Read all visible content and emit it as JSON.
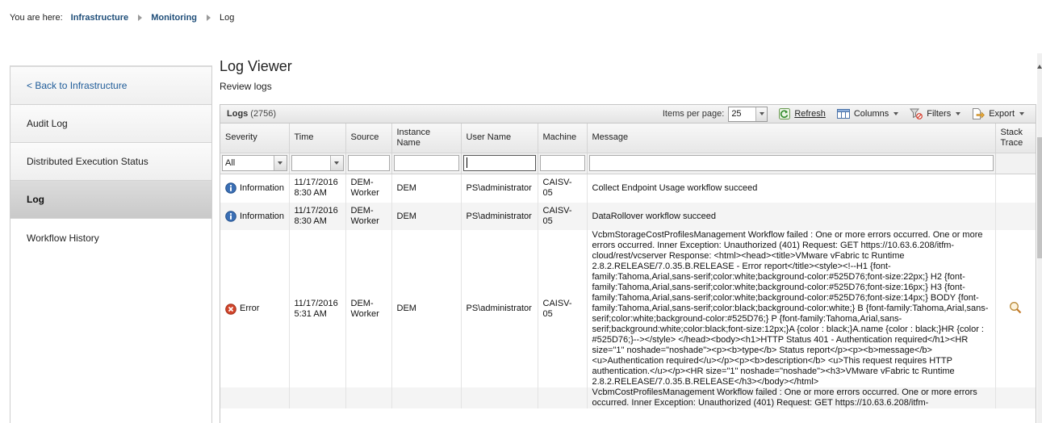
{
  "breadcrumb": {
    "label": "You are here:",
    "items": [
      "Infrastructure",
      "Monitoring"
    ],
    "current": "Log"
  },
  "sidebar": {
    "items": [
      {
        "label": "< Back to Infrastructure"
      },
      {
        "label": "Audit Log"
      },
      {
        "label": "Distributed Execution Status"
      },
      {
        "label": "Log"
      },
      {
        "label": "Workflow History"
      }
    ],
    "active": "Log"
  },
  "header": {
    "title": "Log Viewer",
    "subtitle": "Review logs"
  },
  "grid": {
    "title": "Logs",
    "count": "(2756)",
    "items_per_page_label": "Items per page:",
    "items_per_page_value": "25",
    "refresh_label": "Refresh",
    "columns_label": "Columns",
    "filters_label": "Filters",
    "export_label": "Export",
    "columns": [
      "Severity",
      "Time",
      "Source",
      "Instance Name",
      "User Name",
      "Machine",
      "Message",
      "Stack Trace"
    ],
    "filter_severity_value": "All",
    "rows": [
      {
        "severity": "Information",
        "time": "11/17/2016 8:30 AM",
        "source": "DEM-Worker",
        "instance": "DEM",
        "user": "PS\\administrator",
        "machine": "CAISV-05",
        "message": "Collect Endpoint Usage workflow succeed"
      },
      {
        "severity": "Information",
        "time": "11/17/2016 8:30 AM",
        "source": "DEM-Worker",
        "instance": "DEM",
        "user": "PS\\administrator",
        "machine": "CAISV-05",
        "message": "DataRollover workflow succeed"
      },
      {
        "severity": "Error",
        "time": "11/17/2016 5:31 AM",
        "source": "DEM-Worker",
        "instance": "DEM",
        "user": "PS\\administrator",
        "machine": "CAISV-05",
        "message": "VcbmStorageCostProfilesManagement Workflow failed : One or more errors occurred. One or more errors occurred. Inner Exception: Unauthorized (401) Request: GET https://10.63.6.208/itfm-cloud/rest/vcserver Response: <html><head><title>VMware vFabric tc Runtime 2.8.2.RELEASE/7.0.35.B.RELEASE - Error report</title><style><!--H1 {font-family:Tahoma,Arial,sans-serif;color:white;background-color:#525D76;font-size:22px;} H2 {font-family:Tahoma,Arial,sans-serif;color:white;background-color:#525D76;font-size:16px;} H3 {font-family:Tahoma,Arial,sans-serif;color:white;background-color:#525D76;font-size:14px;} BODY {font-family:Tahoma,Arial,sans-serif;color:black;background-color:white;} B {font-family:Tahoma,Arial,sans-serif;color:white;background-color:#525D76;} P {font-family:Tahoma,Arial,sans-serif;background:white;color:black;font-size:12px;}A {color : black;}A.name {color : black;}HR {color : #525D76;}--></style> </head><body><h1>HTTP Status 401 - Authentication required</h1><HR size=\"1\" noshade=\"noshade\"><p><b>type</b> Status report</p><p><b>message</b> <u>Authentication required</u></p><p><b>description</b> <u>This request requires HTTP authentication.</u></p><HR size=\"1\" noshade=\"noshade\"><h3>VMware vFabric tc Runtime 2.8.2.RELEASE/7.0.35.B.RELEASE</h3></body></html>"
      },
      {
        "severity": "",
        "time": "",
        "source": "",
        "instance": "",
        "user": "",
        "machine": "",
        "message": "VcbmCostProfilesManagement Workflow failed : One or more errors occurred. One or more errors occurred. Inner Exception: Unauthorized (401) Request: GET https://10.63.6.208/itfm-"
      }
    ]
  },
  "colors": {
    "link": "#1f4e79",
    "info_icon": "#3a6fb5",
    "error_icon": "#d2452b",
    "active_nav": "#cfcfcf"
  },
  "icons": {
    "information": "info-icon",
    "error": "error-icon",
    "stack_trace": "magnifier-icon",
    "refresh": "refresh-icon",
    "columns": "columns-icon",
    "filters": "filter-icon",
    "export": "export-icon"
  }
}
